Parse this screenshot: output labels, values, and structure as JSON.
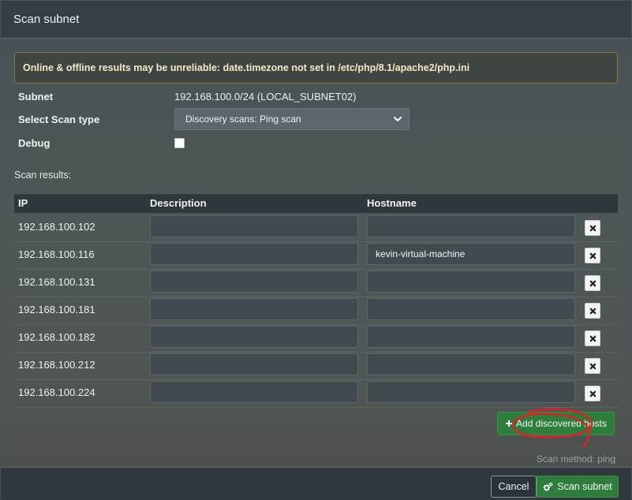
{
  "modal": {
    "title": "Scan subnet"
  },
  "alert": {
    "text": "Online & offline results may be unreliable: date.timezone not set in /etc/php/8.1/apache2/php.ini"
  },
  "form": {
    "subnet_label": "Subnet",
    "subnet_value": "192.168.100.0/24 (LOCAL_SUBNET02)",
    "scan_type_label": "Select Scan type",
    "scan_type_value": "Discovery scans: Ping scan",
    "debug_label": "Debug",
    "debug_checked": false
  },
  "results": {
    "label": "Scan results:",
    "columns": {
      "ip": "IP",
      "description": "Description",
      "hostname": "Hostname"
    },
    "rows": [
      {
        "ip": "192.168.100.102",
        "description": "",
        "hostname": ""
      },
      {
        "ip": "192.168.100.116",
        "description": "",
        "hostname": "kevin-virtual-machine"
      },
      {
        "ip": "192.168.100.131",
        "description": "",
        "hostname": ""
      },
      {
        "ip": "192.168.100.181",
        "description": "",
        "hostname": ""
      },
      {
        "ip": "192.168.100.182",
        "description": "",
        "hostname": ""
      },
      {
        "ip": "192.168.100.212",
        "description": "",
        "hostname": ""
      },
      {
        "ip": "192.168.100.224",
        "description": "",
        "hostname": ""
      }
    ],
    "add_button_label": "Add discovered hosts",
    "scan_method": "Scan method: ping"
  },
  "footer": {
    "cancel_label": "Cancel",
    "scan_label": "Scan subnet"
  },
  "colors": {
    "accent_green": "#2e7d3c",
    "annotation_red": "#e0202a"
  }
}
